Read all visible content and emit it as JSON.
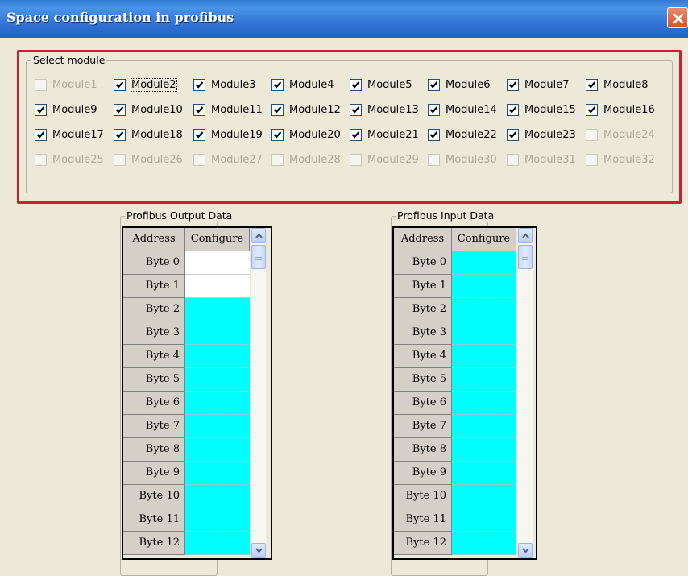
{
  "window": {
    "title": "Space configuration in profibus"
  },
  "select_module": {
    "legend": "Select module",
    "modules": [
      {
        "label": "Module1",
        "checked": false,
        "enabled": false
      },
      {
        "label": "Module2",
        "checked": true,
        "enabled": true,
        "focused": true
      },
      {
        "label": "Module3",
        "checked": true,
        "enabled": true
      },
      {
        "label": "Module4",
        "checked": true,
        "enabled": true
      },
      {
        "label": "Module5",
        "checked": true,
        "enabled": true
      },
      {
        "label": "Module6",
        "checked": true,
        "enabled": true
      },
      {
        "label": "Module7",
        "checked": true,
        "enabled": true
      },
      {
        "label": "Module8",
        "checked": true,
        "enabled": true
      },
      {
        "label": "Module9",
        "checked": true,
        "enabled": true
      },
      {
        "label": "Module10",
        "checked": true,
        "enabled": true
      },
      {
        "label": "Module11",
        "checked": true,
        "enabled": true
      },
      {
        "label": "Module12",
        "checked": true,
        "enabled": true
      },
      {
        "label": "Module13",
        "checked": true,
        "enabled": true
      },
      {
        "label": "Module14",
        "checked": true,
        "enabled": true
      },
      {
        "label": "Module15",
        "checked": true,
        "enabled": true
      },
      {
        "label": "Module16",
        "checked": true,
        "enabled": true
      },
      {
        "label": "Module17",
        "checked": true,
        "enabled": true
      },
      {
        "label": "Module18",
        "checked": true,
        "enabled": true
      },
      {
        "label": "Module19",
        "checked": true,
        "enabled": true
      },
      {
        "label": "Module20",
        "checked": true,
        "enabled": true
      },
      {
        "label": "Module21",
        "checked": true,
        "enabled": true
      },
      {
        "label": "Module22",
        "checked": true,
        "enabled": true
      },
      {
        "label": "Module23",
        "checked": true,
        "enabled": true
      },
      {
        "label": "Module24",
        "checked": false,
        "enabled": false
      },
      {
        "label": "Module25",
        "checked": false,
        "enabled": false
      },
      {
        "label": "Module26",
        "checked": false,
        "enabled": false
      },
      {
        "label": "Module27",
        "checked": false,
        "enabled": false
      },
      {
        "label": "Module28",
        "checked": false,
        "enabled": false
      },
      {
        "label": "Module29",
        "checked": false,
        "enabled": false
      },
      {
        "label": "Module30",
        "checked": false,
        "enabled": false
      },
      {
        "label": "Module31",
        "checked": false,
        "enabled": false
      },
      {
        "label": "Module32",
        "checked": false,
        "enabled": false
      }
    ]
  },
  "output_data": {
    "legend": "Profibus Output Data",
    "columns": [
      "Address",
      "Configure"
    ],
    "rows": [
      {
        "address": "Byte 0",
        "configured": false
      },
      {
        "address": "Byte 1",
        "configured": false
      },
      {
        "address": "Byte 2",
        "configured": true
      },
      {
        "address": "Byte 3",
        "configured": true
      },
      {
        "address": "Byte 4",
        "configured": true
      },
      {
        "address": "Byte 5",
        "configured": true
      },
      {
        "address": "Byte 6",
        "configured": true
      },
      {
        "address": "Byte 7",
        "configured": true
      },
      {
        "address": "Byte 8",
        "configured": true
      },
      {
        "address": "Byte 9",
        "configured": true
      },
      {
        "address": "Byte 10",
        "configured": true
      },
      {
        "address": "Byte 11",
        "configured": true
      },
      {
        "address": "Byte 12",
        "configured": true
      }
    ]
  },
  "input_data": {
    "legend": "Profibus Input Data",
    "columns": [
      "Address",
      "Configure"
    ],
    "rows": [
      {
        "address": "Byte 0",
        "configured": true
      },
      {
        "address": "Byte 1",
        "configured": true
      },
      {
        "address": "Byte 2",
        "configured": true
      },
      {
        "address": "Byte 3",
        "configured": true
      },
      {
        "address": "Byte 4",
        "configured": true
      },
      {
        "address": "Byte 5",
        "configured": true
      },
      {
        "address": "Byte 6",
        "configured": true
      },
      {
        "address": "Byte 7",
        "configured": true
      },
      {
        "address": "Byte 8",
        "configured": true
      },
      {
        "address": "Byte 9",
        "configured": true
      },
      {
        "address": "Byte 10",
        "configured": true
      },
      {
        "address": "Byte 11",
        "configured": true
      },
      {
        "address": "Byte 12",
        "configured": true
      }
    ]
  },
  "colors": {
    "configured": "#00ffff",
    "unconfigured": "#ffffff",
    "highlight_border": "#cf1f2f",
    "titlebar": "#2e70d2"
  },
  "icons": {
    "close": "close-icon",
    "scroll_up": "chevron-up-icon",
    "scroll_down": "chevron-down-icon",
    "check": "checkmark-icon"
  }
}
